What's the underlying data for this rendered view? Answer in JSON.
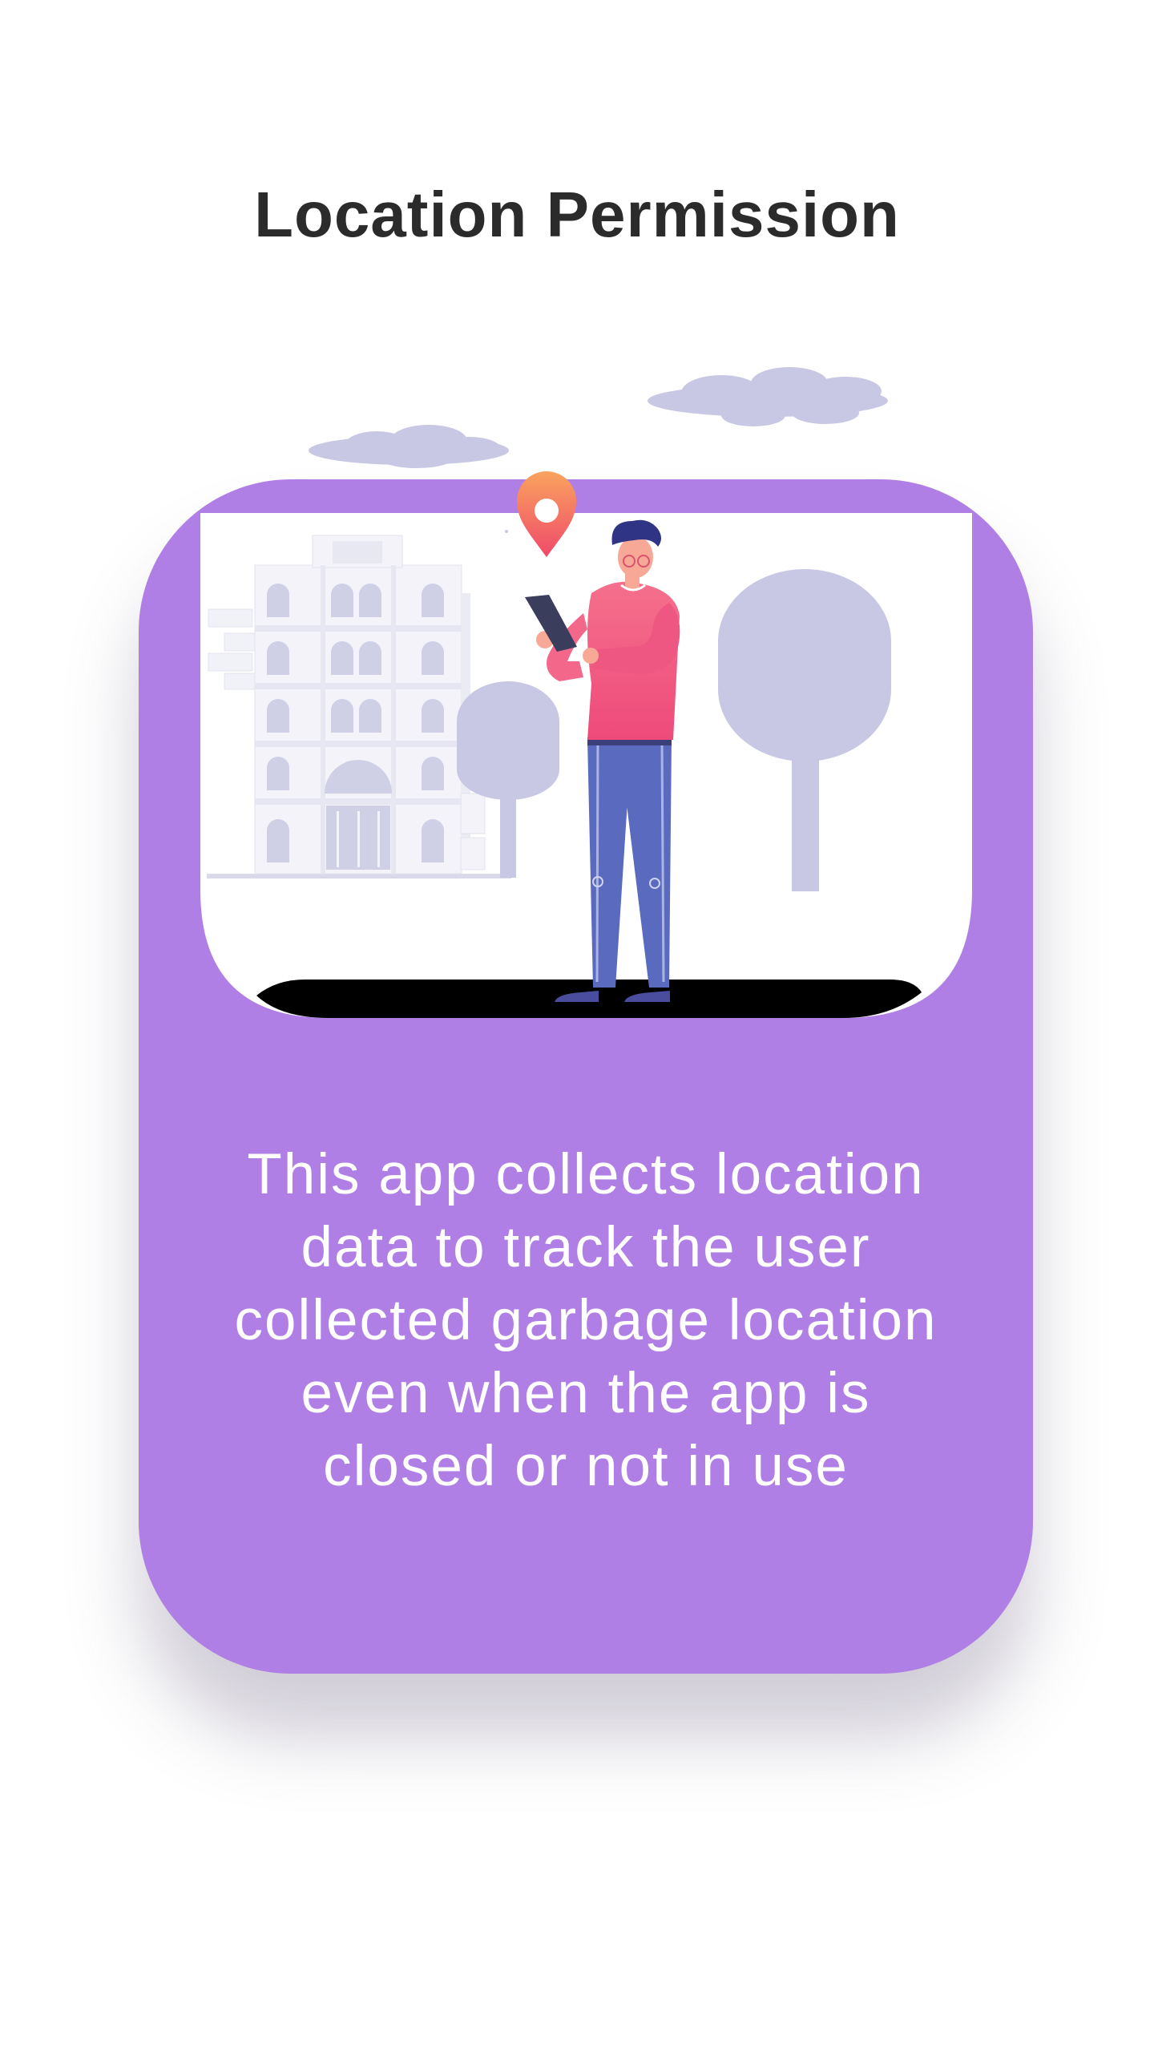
{
  "page": {
    "title": "Location Permission",
    "message_lines": [
      "This app collects location",
      "data to track the user",
      "collected garbage location",
      "even when the app is",
      "closed or not in use"
    ]
  },
  "illustration": {
    "icons": [
      "cloud-icon",
      "building-icon",
      "tree-icon",
      "location-pin-icon",
      "person-with-tablet-icon"
    ]
  },
  "colors": {
    "background": "#ffffff",
    "title": "#2b2b2b",
    "card": "#b07fe5",
    "message_text": "#ffffff",
    "scene_shapes": "#c9c8e4",
    "shirt": "#f0527e",
    "jeans": "#5a6bbf",
    "pin": "#f67e5b"
  }
}
